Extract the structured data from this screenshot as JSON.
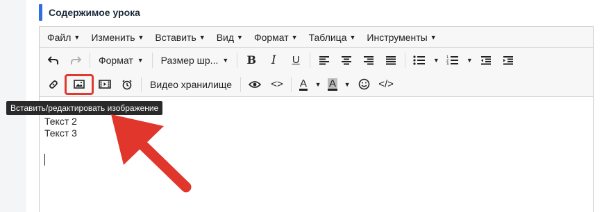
{
  "section": {
    "title": "Содержимое урока"
  },
  "menubar": [
    {
      "label": "Файл"
    },
    {
      "label": "Изменить"
    },
    {
      "label": "Вставить"
    },
    {
      "label": "Вид"
    },
    {
      "label": "Формат"
    },
    {
      "label": "Таблица"
    },
    {
      "label": "Инструменты"
    }
  ],
  "toolbar": {
    "format_label": "Формат",
    "font_size_label": "Размер шр...",
    "video_storage_label": "Видео хранилище",
    "font_color_letter": "A",
    "bg_color_letter": "A",
    "bold_letter": "B",
    "italic_letter": "I",
    "underline_letter": "U",
    "code_label": "<>",
    "source_code_label": "</>"
  },
  "tooltip": {
    "text": "Вставить/редактировать изображение"
  },
  "content": {
    "lines": [
      "Текст 2",
      "Текст 3"
    ]
  },
  "colors": {
    "accent": "#2f6fde",
    "highlight": "#e03a2f"
  }
}
